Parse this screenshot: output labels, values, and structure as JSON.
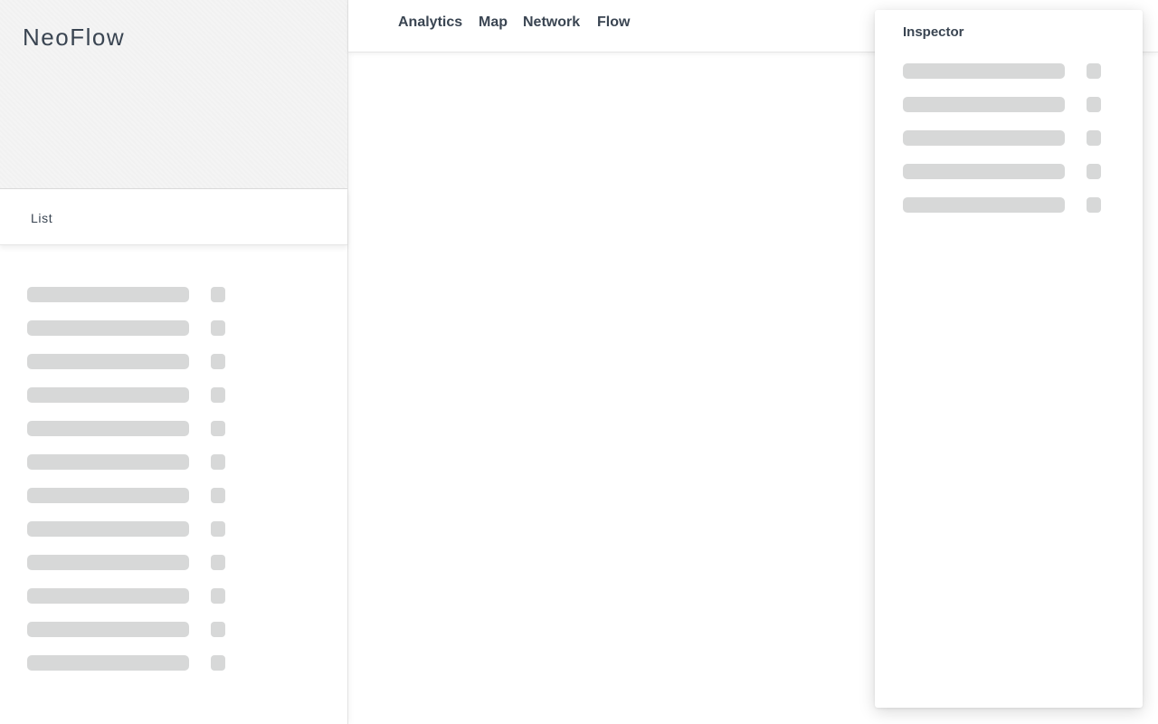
{
  "app": {
    "brand": "NeoFlow"
  },
  "sidebar": {
    "list_label": "List",
    "items": [
      {
        "id": 1
      },
      {
        "id": 2
      },
      {
        "id": 3
      },
      {
        "id": 4
      },
      {
        "id": 5
      },
      {
        "id": 6
      },
      {
        "id": 7
      },
      {
        "id": 8
      },
      {
        "id": 9
      },
      {
        "id": 10
      },
      {
        "id": 11
      },
      {
        "id": 12
      }
    ]
  },
  "nav": {
    "tabs": [
      {
        "label": "Analytics"
      },
      {
        "label": "Map"
      },
      {
        "label": "Network"
      },
      {
        "label": "Flow"
      }
    ]
  },
  "inspector": {
    "title": "Inspector",
    "items": [
      {
        "id": 1
      },
      {
        "id": 2
      },
      {
        "id": 3
      },
      {
        "id": 4
      },
      {
        "id": 5
      }
    ]
  },
  "colors": {
    "text": "#3a4552",
    "placeholder": "#d7d8d8",
    "brand_bg": "#f4f4f4"
  }
}
